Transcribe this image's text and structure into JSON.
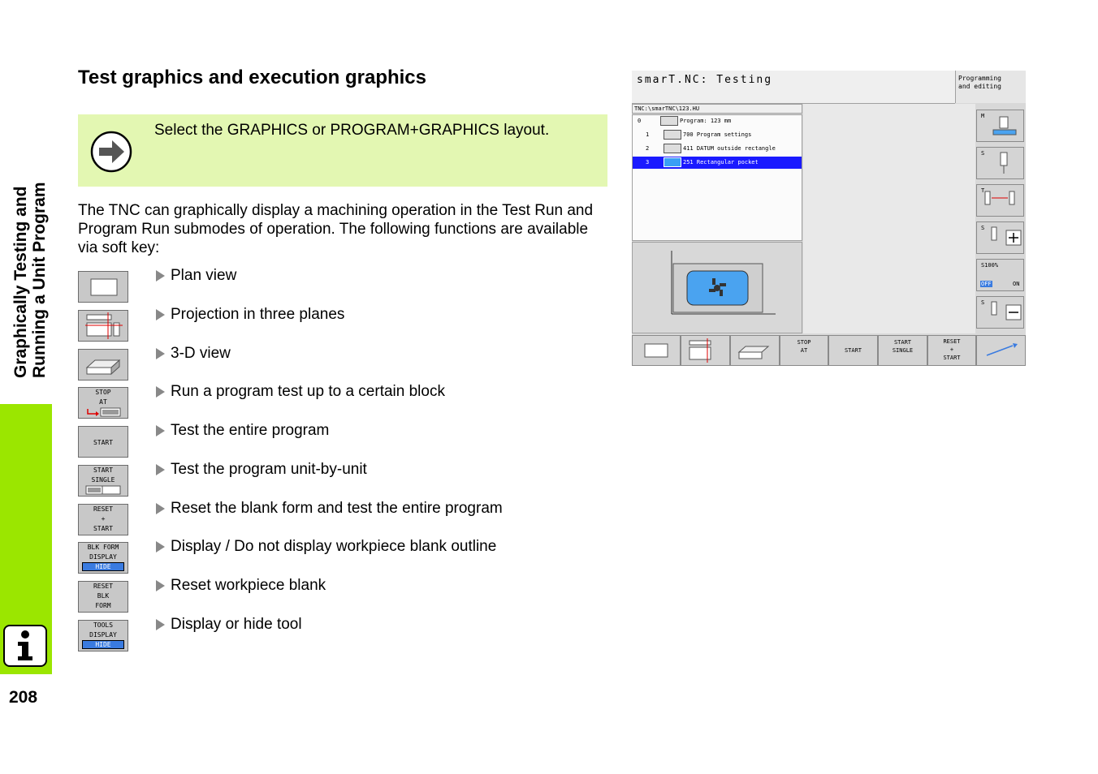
{
  "sidebar": {
    "chapter_title_line1": "Graphically Testing and",
    "chapter_title_line2": "Running a Unit Program",
    "info_icon": "info-icon",
    "accent_color": "#9be600"
  },
  "page_number": "208",
  "section_heading": "Test graphics and execution graphics",
  "note": {
    "icon": "arrow-right-circle-icon",
    "text": "Select the GRAPHICS or PROGRAM+GRAPHICS layout.",
    "background": "#e3f7b2"
  },
  "intro_text": "The TNC can graphically display a machining operation in the Test Run and Program Run submodes of operation. The following functions are available via soft key:",
  "functions": [
    {
      "softkey_lines": [],
      "softkey_icon": "plan-view-icon",
      "description": "Plan view"
    },
    {
      "softkey_lines": [],
      "softkey_icon": "three-planes-icon",
      "description": "Projection in three planes"
    },
    {
      "softkey_lines": [],
      "softkey_icon": "3d-view-icon",
      "description": "3-D view"
    },
    {
      "softkey_lines": [
        "STOP",
        "AT"
      ],
      "softkey_icon": "stop-at-block-icon",
      "description": "Run a program test up to a certain block"
    },
    {
      "softkey_lines": [
        "START"
      ],
      "softkey_icon": "",
      "description": "Test the entire program"
    },
    {
      "softkey_lines": [
        "START",
        "SINGLE"
      ],
      "softkey_icon": "single-block-icon",
      "description": "Test the program unit-by-unit"
    },
    {
      "softkey_lines": [
        "RESET",
        "+",
        "START"
      ],
      "softkey_icon": "",
      "description": "Reset the blank form and test the entire program"
    },
    {
      "softkey_lines": [
        "BLK FORM",
        "DISPLAY"
      ],
      "softkey_highlight": "HIDE",
      "softkey_icon": "",
      "description": "Display / Do not display workpiece blank outline"
    },
    {
      "softkey_lines": [
        "RESET",
        "BLK",
        "FORM"
      ],
      "softkey_icon": "",
      "description": "Reset workpiece blank"
    },
    {
      "softkey_lines": [
        "TOOLS",
        "DISPLAY"
      ],
      "softkey_highlight": "HIDE",
      "softkey_icon": "",
      "description": "Display or hide tool"
    }
  ],
  "screenshot": {
    "title": "smarT.NC: Testing",
    "mode_line1": "Programming",
    "mode_line2": "and editing",
    "path": "TNC:\\smarTNC\\123.HU",
    "tree": [
      {
        "num": "0",
        "label": "Program: 123 mm",
        "selected": false
      },
      {
        "num": "1",
        "label": "700 Program settings",
        "selected": false
      },
      {
        "num": "2",
        "label": "411 DATUM outside rectangle",
        "selected": false
      },
      {
        "num": "3",
        "label": "251 Rectangular pocket",
        "selected": true
      }
    ],
    "vertical_softkeys": [
      {
        "label": "M"
      },
      {
        "label": "S"
      },
      {
        "label": "T"
      },
      {
        "label": "S"
      },
      {
        "label": "S100%",
        "off": "OFF",
        "on": "ON"
      },
      {
        "label": "S"
      }
    ],
    "horizontal_softkeys": [
      {
        "lines": []
      },
      {
        "lines": []
      },
      {
        "lines": []
      },
      {
        "lines": [
          "STOP",
          "AT"
        ]
      },
      {
        "lines": [
          "START"
        ]
      },
      {
        "lines": [
          "START",
          "SINGLE"
        ]
      },
      {
        "lines": [
          "RESET",
          "+",
          "START"
        ]
      },
      {
        "lines": []
      }
    ],
    "selection_color": "#1a1aff"
  }
}
